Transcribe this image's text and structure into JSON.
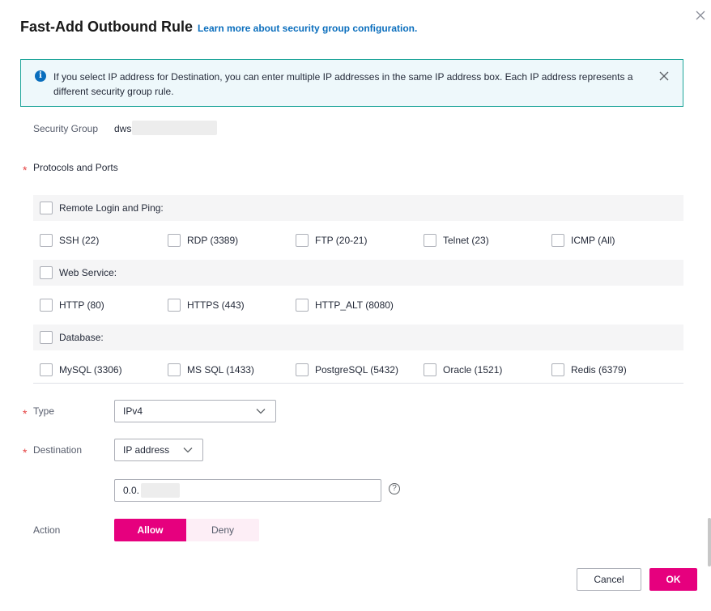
{
  "dialog": {
    "title": "Fast-Add Outbound Rule",
    "learn_link": "Learn more about security group configuration."
  },
  "alert": {
    "text": "If you select IP address for Destination, you can enter multiple IP addresses in the same IP address box. Each IP address represents a different security group rule."
  },
  "security_group": {
    "label": "Security Group",
    "value": "dws"
  },
  "protocols": {
    "label": "Protocols and Ports",
    "groups": [
      {
        "label": "Remote Login and Ping:",
        "items": [
          "SSH (22)",
          "RDP (3389)",
          "FTP (20-21)",
          "Telnet (23)",
          "ICMP (All)"
        ]
      },
      {
        "label": "Web Service:",
        "items": [
          "HTTP (80)",
          "HTTPS (443)",
          "HTTP_ALT (8080)"
        ]
      },
      {
        "label": "Database:",
        "items": [
          "MySQL (3306)",
          "MS SQL (1433)",
          "PostgreSQL (5432)",
          "Oracle (1521)",
          "Redis (6379)"
        ]
      }
    ]
  },
  "type": {
    "label": "Type",
    "value": "IPv4"
  },
  "destination": {
    "label": "Destination",
    "value": "IP address",
    "ip_value": "0.0."
  },
  "action": {
    "label": "Action",
    "allow": "Allow",
    "deny": "Deny"
  },
  "footer": {
    "cancel": "Cancel",
    "ok": "OK"
  },
  "colors": {
    "accent": "#e6007e",
    "link": "#0a6ebd",
    "alert_border": "#1ea59a",
    "required": "#e54545"
  },
  "icons": [
    "close-icon",
    "info-icon",
    "chevron-down-icon",
    "help-icon"
  ]
}
